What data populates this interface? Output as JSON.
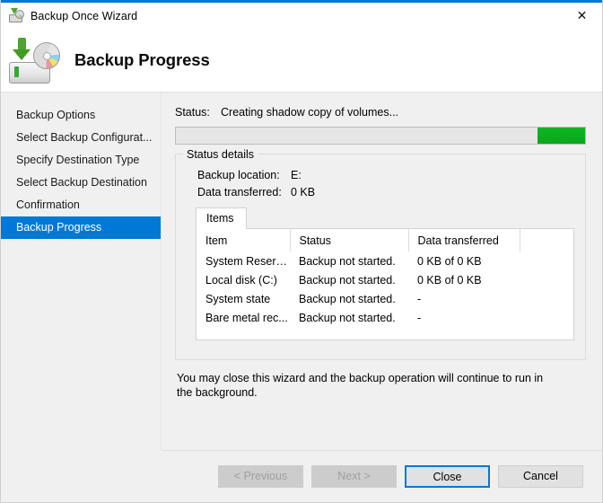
{
  "window": {
    "title": "Backup Once Wizard",
    "title_icon": "backup-drive-icon",
    "close_label": "✕",
    "accent_color": "#0078d7"
  },
  "banner": {
    "icon": "backup-drive-icon",
    "heading": "Backup Progress"
  },
  "sidebar": {
    "items": [
      {
        "label": "Backup Options",
        "selected": false
      },
      {
        "label": "Select Backup Configurat...",
        "selected": false
      },
      {
        "label": "Specify Destination Type",
        "selected": false
      },
      {
        "label": "Select Backup Destination",
        "selected": false
      },
      {
        "label": "Confirmation",
        "selected": false
      },
      {
        "label": "Backup Progress",
        "selected": true
      }
    ],
    "selection_color": "#0078d7"
  },
  "main": {
    "status_label": "Status:",
    "status_value": "Creating shadow copy of volumes...",
    "progress": {
      "style": "marquee",
      "fill_color": "#0bb01f",
      "position": "right"
    },
    "group": {
      "title": "Status details",
      "fields": [
        {
          "key": "Backup location:",
          "value": "E:"
        },
        {
          "key": "Data transferred:",
          "value": "0 KB"
        }
      ],
      "tabs": [
        {
          "label": "Items",
          "selected": true
        }
      ],
      "table": {
        "columns": [
          "Item",
          "Status",
          "Data transferred",
          ""
        ],
        "rows": [
          [
            "System Reserv...",
            "Backup not started.",
            "0 KB of 0 KB",
            ""
          ],
          [
            "Local disk (C:)",
            "Backup not started.",
            "0 KB of 0 KB",
            ""
          ],
          [
            "System state",
            "Backup not started.",
            "-",
            ""
          ],
          [
            "Bare metal rec...",
            "Backup not started.",
            "-",
            ""
          ]
        ]
      }
    },
    "note": "You may close this wizard and the backup operation will continue to run in the background."
  },
  "footer": {
    "buttons": [
      {
        "label": "< Previous",
        "state": "disabled"
      },
      {
        "label": "Next >",
        "state": "disabled"
      },
      {
        "label": "Close",
        "state": "default"
      },
      {
        "label": "Cancel",
        "state": "normal"
      }
    ]
  }
}
